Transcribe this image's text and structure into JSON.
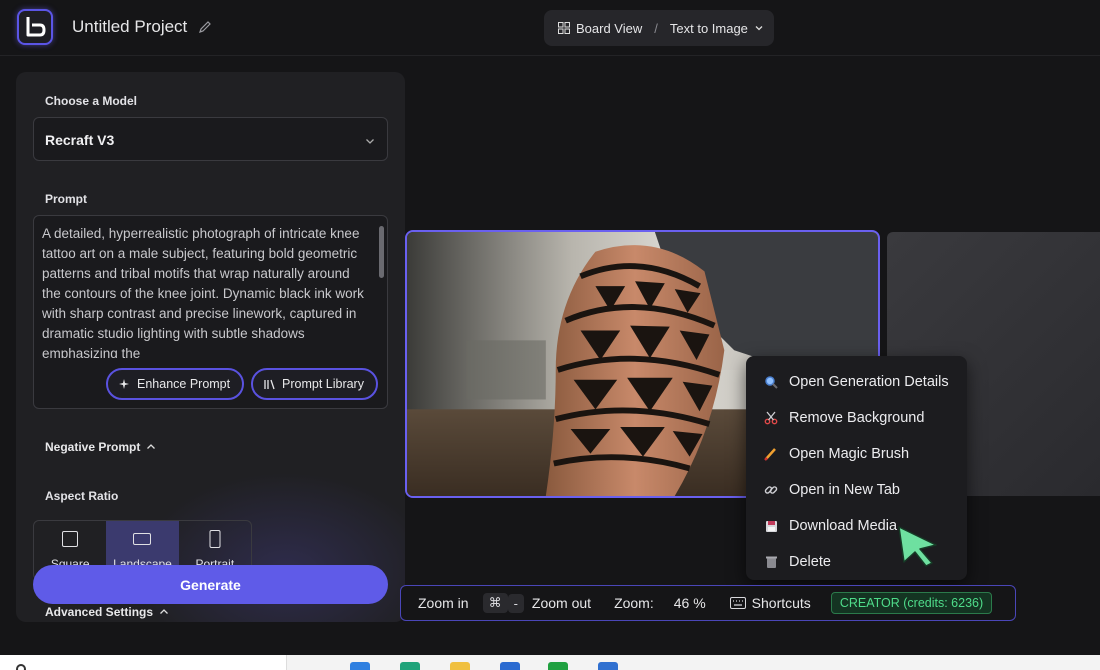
{
  "header": {
    "project_title": "Untitled Project",
    "view_mode": "Board View",
    "separator": "/",
    "generation_type": "Text to Image"
  },
  "sidebar": {
    "model_label": "Choose a Model",
    "model_value": "Recraft V3",
    "prompt_label": "Prompt",
    "prompt_text": "A detailed, hyperrealistic photograph of intricate knee tattoo art on a male subject, featuring bold geometric patterns and tribal motifs that wrap naturally around the contours of the knee joint. Dynamic black ink work with sharp contrast and precise linework, captured in dramatic studio lighting with subtle shadows emphasizing the",
    "enhance_label": "Enhance Prompt",
    "library_label": "Prompt Library",
    "negative_label": "Negative Prompt",
    "aspect_label": "Aspect Ratio",
    "aspect_options": [
      "Square",
      "Landscape",
      "Portrait"
    ],
    "aspect_selected": "Landscape",
    "generate_label": "Generate",
    "advanced_label": "Advanced Settings"
  },
  "context_menu": {
    "items": [
      {
        "label": "Open Generation Details",
        "icon": "magnifier-icon"
      },
      {
        "label": "Remove Background",
        "icon": "scissors-icon"
      },
      {
        "label": "Open Magic Brush",
        "icon": "brush-icon"
      },
      {
        "label": "Open in New Tab",
        "icon": "link-icon"
      },
      {
        "label": "Download Media",
        "icon": "floppy-disk-icon"
      },
      {
        "label": "Delete",
        "icon": "trash-icon"
      }
    ]
  },
  "toolbar": {
    "zoom_in_label": "Zoom in",
    "cmd_key": "⌘",
    "minus_key": "-",
    "zoom_out_label": "Zoom out",
    "zoom_label": "Zoom:",
    "zoom_value": "46 %",
    "shortcuts_label": "Shortcuts",
    "plan_badge": "CREATOR (credits: 6236)"
  },
  "colors": {
    "accent": "#5f5be8",
    "panel_bg": "#202023",
    "canvas_bg": "#151517",
    "credits_green": "#4fdc8a"
  }
}
